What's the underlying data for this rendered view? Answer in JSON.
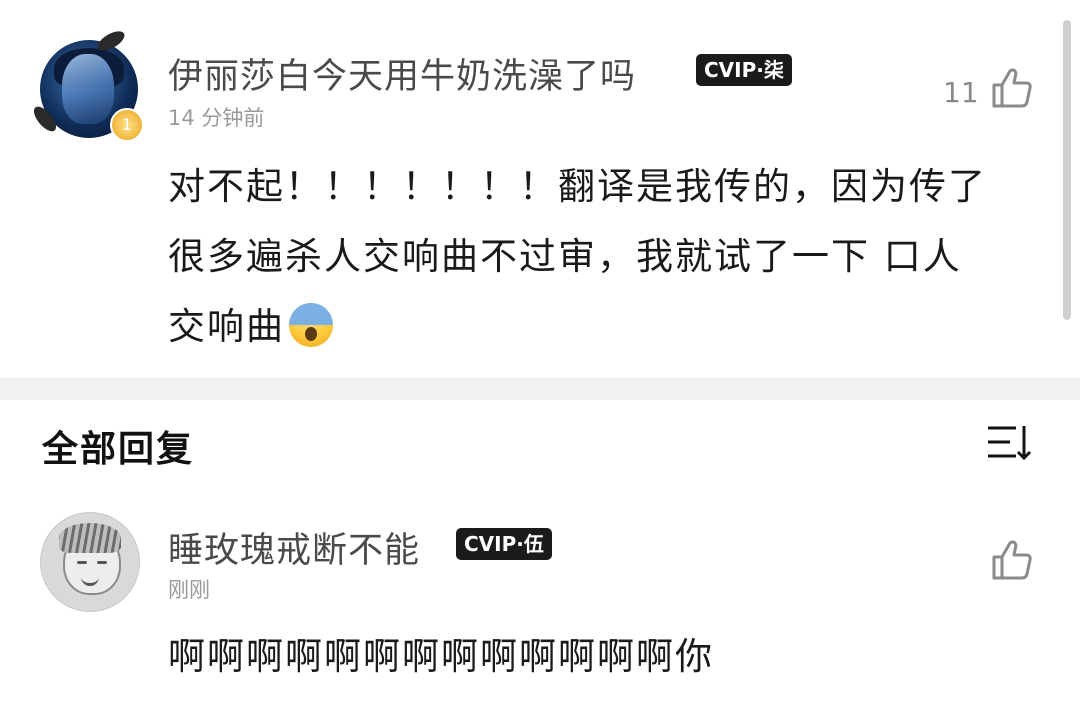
{
  "comment": {
    "username": "伊丽莎白今天用牛奶洗澡了吗",
    "vip_badge": "CVIP·柒",
    "time": "14 分钟前",
    "content_lines": [
      "对不起！！！！！！！翻译是我传的，因为传了",
      "很多遍杀人交响曲不过审，我就试了一下 口人",
      "交响曲"
    ],
    "emoji": "scream-emoji",
    "like_count": "11",
    "level_badge": "1"
  },
  "replies_section": {
    "title": "全部回复",
    "sort_icon": "sort-icon"
  },
  "reply": {
    "username": "睡玫瑰戒断不能",
    "vip_badge": "CVIP·伍",
    "time": "刚刚",
    "content": "啊啊啊啊啊啊啊啊啊啊啊啊啊你"
  },
  "colors": {
    "divider": "#f2f2f2",
    "vip_bg": "#1b1b1b"
  }
}
